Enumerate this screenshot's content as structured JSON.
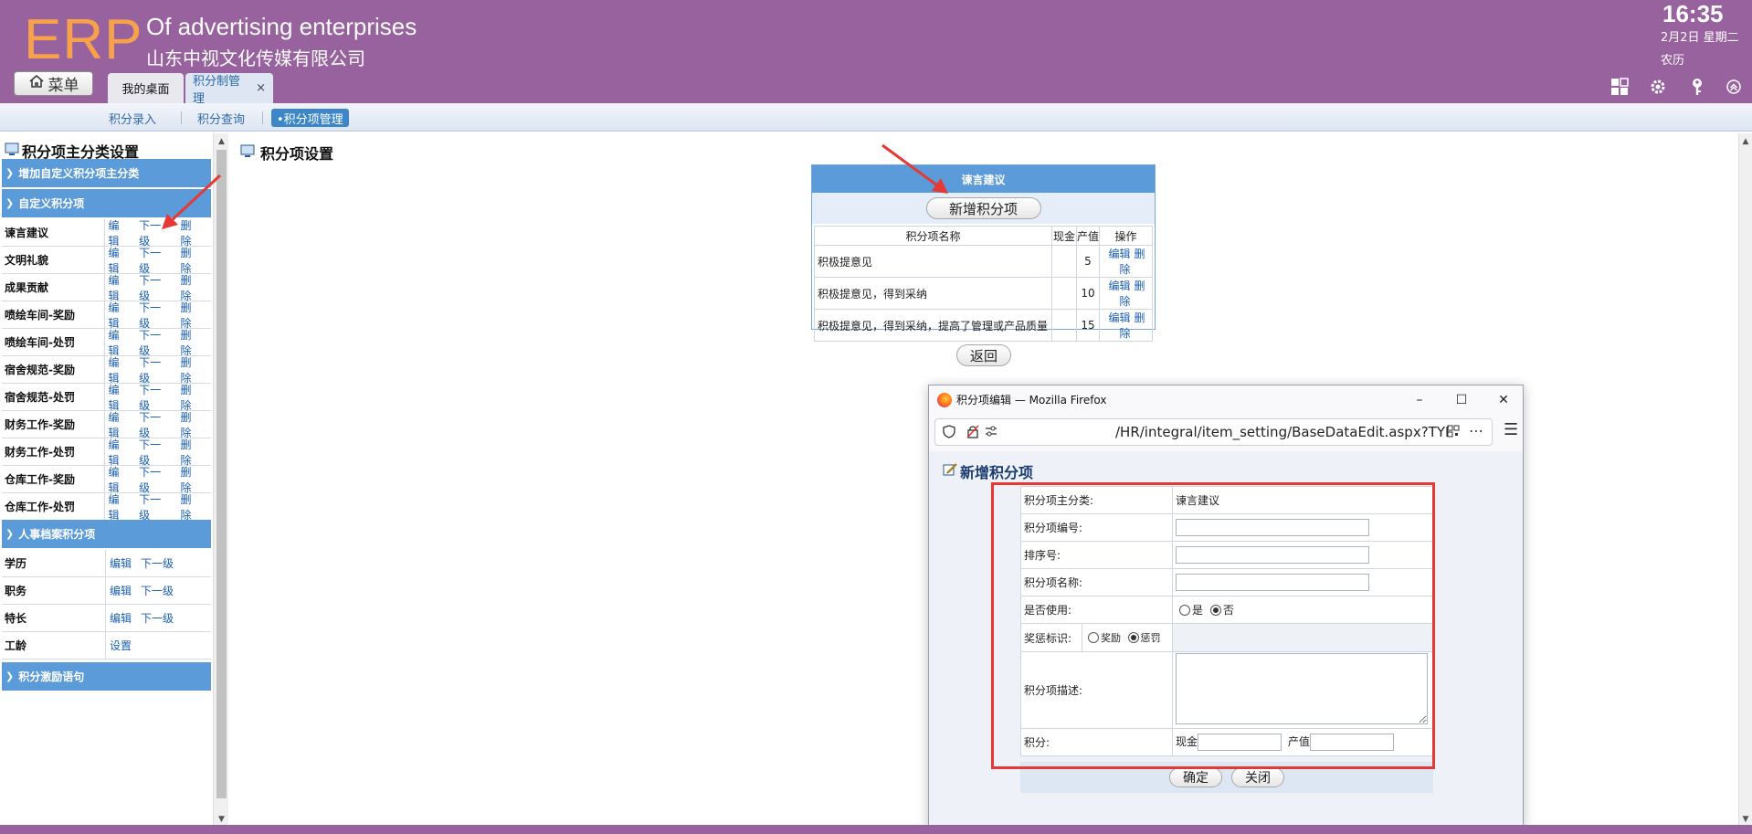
{
  "header": {
    "logo": "ERP",
    "company_en": "Of advertising enterprises",
    "company_cn": "山东中视文化传媒有限公司",
    "menu_label": "菜单",
    "tabs": [
      {
        "label": "我的桌面"
      },
      {
        "label": "积分制管理",
        "close": "×"
      }
    ],
    "clock": {
      "time": "16:35",
      "date": "2月2日 星期二",
      "lunar": "农历"
    },
    "icons": [
      "grid-icon",
      "gear-icon",
      "key-icon",
      "collapse-up-icon"
    ],
    "colors": {
      "header_bg": "#98629e",
      "logo": "#f7a24a"
    }
  },
  "subnav": {
    "items": [
      {
        "label": "积分录入"
      },
      {
        "label": "积分查询"
      },
      {
        "label": "•积分项管理"
      }
    ]
  },
  "left": {
    "title": "积分项主分类设置",
    "sections": [
      {
        "label": "增加自定义积分项主分类"
      },
      {
        "label": "自定义积分项"
      },
      {
        "label": "人事档案积分项"
      },
      {
        "label": "积分激励语句"
      }
    ],
    "custom_rows": [
      {
        "name": "谏言建议",
        "a1": "编辑",
        "a2": "下一级",
        "a3": "删除"
      },
      {
        "name": "文明礼貌",
        "a1": "编辑",
        "a2": "下一级",
        "a3": "删除"
      },
      {
        "name": "成果贡献",
        "a1": "编辑",
        "a2": "下一级",
        "a3": "删除"
      },
      {
        "name": "喷绘车间-奖励",
        "a1": "编辑",
        "a2": "下一级",
        "a3": "删除"
      },
      {
        "name": "喷绘车间-处罚",
        "a1": "编辑",
        "a2": "下一级",
        "a3": "删除"
      },
      {
        "name": "宿舍规范-奖励",
        "a1": "编辑",
        "a2": "下一级",
        "a3": "删除"
      },
      {
        "name": "宿舍规范-处罚",
        "a1": "编辑",
        "a2": "下一级",
        "a3": "删除"
      },
      {
        "name": "财务工作-奖励",
        "a1": "编辑",
        "a2": "下一级",
        "a3": "删除"
      },
      {
        "name": "财务工作-处罚",
        "a1": "编辑",
        "a2": "下一级",
        "a3": "删除"
      },
      {
        "name": "仓库工作-奖励",
        "a1": "编辑",
        "a2": "下一级",
        "a3": "删除"
      },
      {
        "name": "仓库工作-处罚",
        "a1": "编辑",
        "a2": "下一级",
        "a3": "删除"
      }
    ],
    "hr_rows": [
      {
        "name": "学历",
        "a1": "编辑",
        "a2": "下一级"
      },
      {
        "name": "职务",
        "a1": "编辑",
        "a2": "下一级"
      },
      {
        "name": "特长",
        "a1": "编辑",
        "a2": "下一级"
      },
      {
        "name": "工龄",
        "a1": "设置"
      }
    ]
  },
  "main": {
    "title": "积分项设置",
    "category_header": "谏言建议",
    "add_button": "新增积分项",
    "columns": [
      "积分项名称",
      "现金",
      "产值",
      "操作"
    ],
    "rows": [
      {
        "name": "积极提意见",
        "cash": "",
        "value": "5",
        "edit": "编辑",
        "del": "删除"
      },
      {
        "name": "积极提意见，得到采纳",
        "cash": "",
        "value": "10",
        "edit": "编辑",
        "del": "删除"
      },
      {
        "name": "积极提意见，得到采纳，提高了管理或产品质量",
        "cash": "",
        "value": "15",
        "edit": "编辑",
        "del": "删除"
      }
    ],
    "back_button": "返回"
  },
  "popup": {
    "window_title": "积分项编辑 — Mozilla Firefox",
    "url": "/HR/integral/item_setting/BaseDataEdit.aspx?TYPE_FRC",
    "heading": "新增积分项",
    "form": {
      "main_category_label": "积分项主分类:",
      "main_category_value": "谏言建议",
      "code_label": "积分项编号:",
      "order_label": "排序号:",
      "name_label": "积分项名称:",
      "enabled_label": "是否使用:",
      "enabled_yes": "是",
      "enabled_no": "否",
      "reward_label": "奖惩标识:",
      "reward_opt": "奖励",
      "punish_opt": "惩罚",
      "desc_label": "积分项描述:",
      "points_label": "积分:",
      "cash_label": "现金",
      "value_label": "产值"
    },
    "ok_button": "确定",
    "close_button": "关闭"
  }
}
